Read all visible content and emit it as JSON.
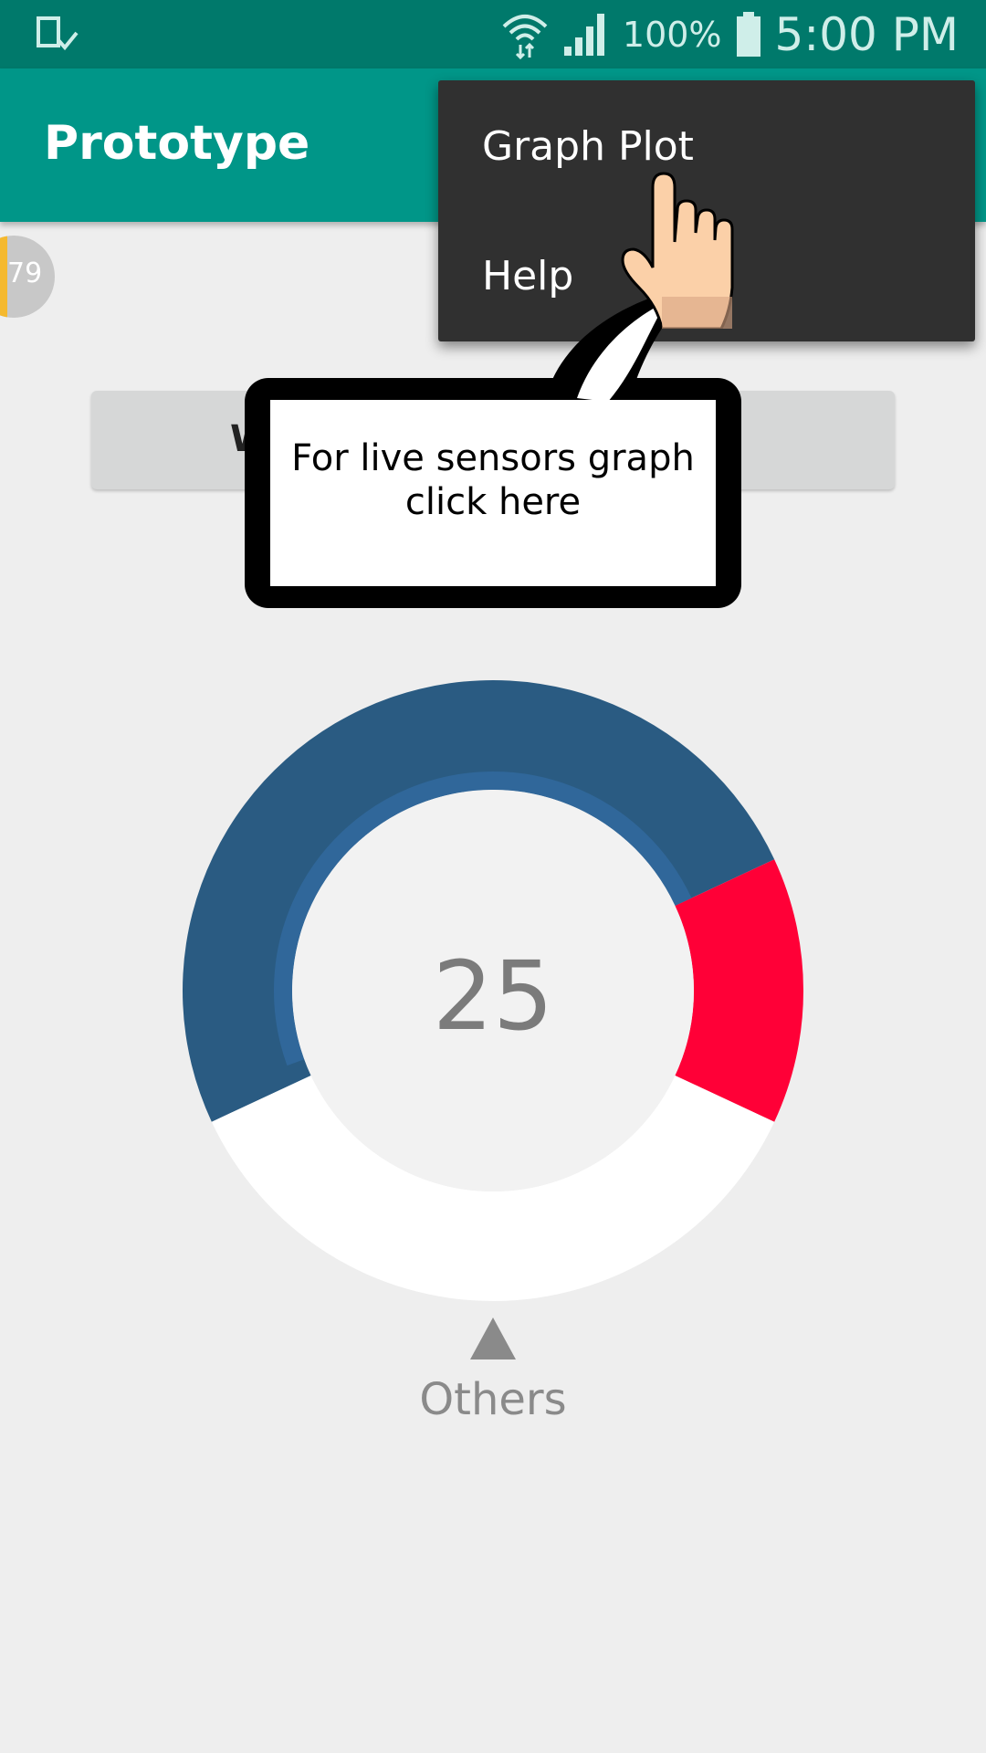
{
  "status_bar": {
    "battery": "100%",
    "time": "5:00 PM",
    "icons": [
      "screenshot-notification-icon",
      "wifi-icon",
      "signal-icon",
      "battery-icon"
    ]
  },
  "app_bar": {
    "title": "Prototype"
  },
  "badge": {
    "value": "79",
    "accent": "#f5b92e"
  },
  "button": {
    "label_visible": "W"
  },
  "menu": {
    "items": [
      {
        "label": "Graph Plot"
      },
      {
        "label": "Help"
      }
    ]
  },
  "tutorial": {
    "callout_text_line1": "For live sensors graph",
    "callout_text_line2": "click here"
  },
  "gauge": {
    "center_value": "25",
    "selected_label": "Others",
    "colors": {
      "blue": "#2a5b82",
      "red": "#ff0037",
      "white": "#ffffff"
    }
  },
  "colors": {
    "status_bar": "#00796b",
    "app_bar": "#009688",
    "menu_bg": "#303030",
    "background": "#eeeeee"
  }
}
